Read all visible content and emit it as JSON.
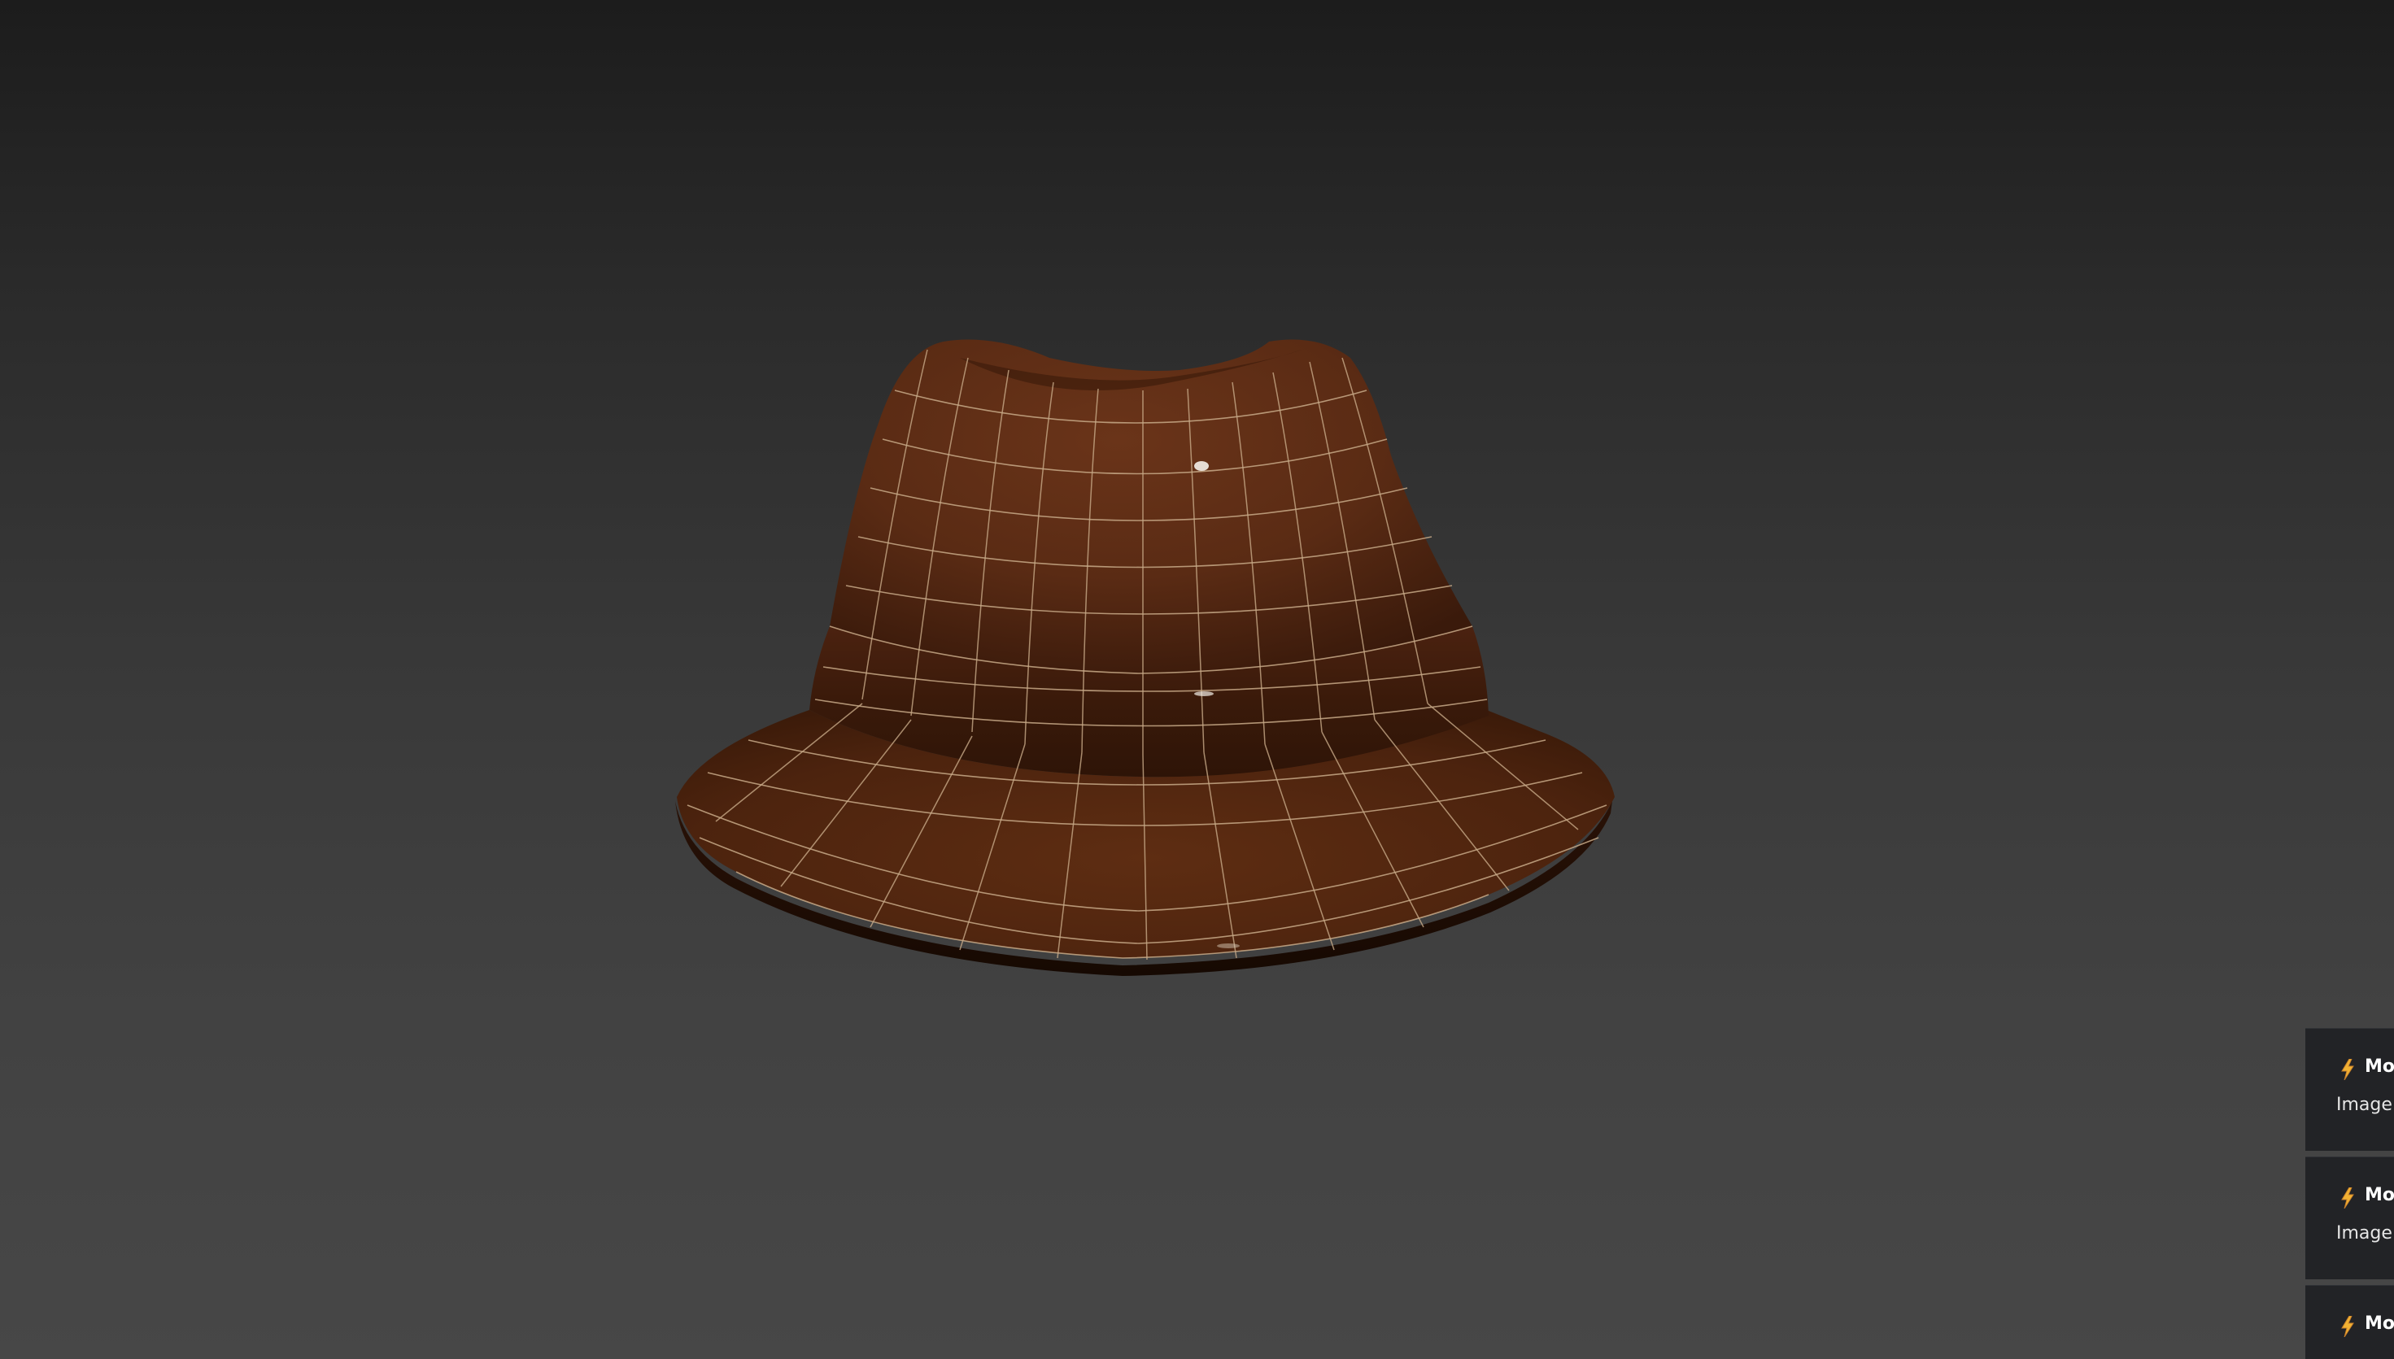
{
  "viewport": {
    "object_name": "fedora-hat",
    "background_top": "#1c1c1c",
    "background_bottom": "#474747",
    "material_color": "#5a2d16",
    "wireframe_color": "#c8aa88"
  },
  "toasts": [
    {
      "icon": "lightning-icon",
      "title": "Mo",
      "body": "Image c"
    },
    {
      "icon": "lightning-icon",
      "title": "Mo",
      "body": "Image c"
    },
    {
      "icon": "lightning-icon",
      "title": "Mo",
      "body": ""
    }
  ]
}
